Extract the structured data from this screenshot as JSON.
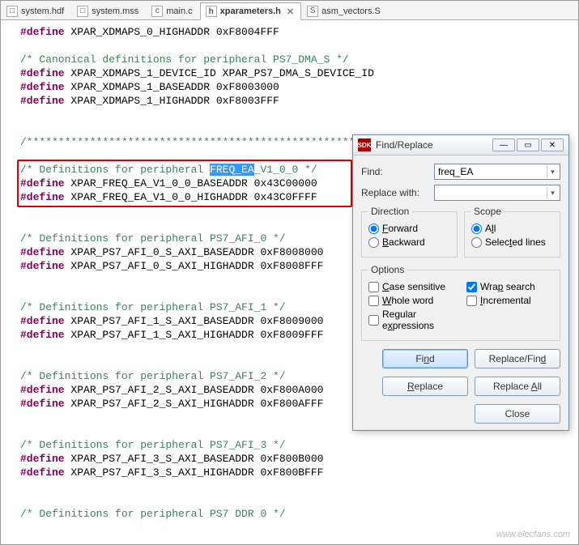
{
  "tabs": [
    {
      "label": "system.hdf",
      "active": false
    },
    {
      "label": "system.mss",
      "active": false
    },
    {
      "label": "main.c",
      "active": false
    },
    {
      "label": "xparameters.h",
      "active": true
    },
    {
      "label": "asm_vectors.S",
      "active": false
    }
  ],
  "code": {
    "lines": [
      {
        "type": "define",
        "ident": "XPAR_XDMAPS_0_HIGHADDR",
        "value": "0xF8004FFF"
      },
      {
        "type": "blank"
      },
      {
        "type": "comment",
        "text": "/* Canonical definitions for peripheral PS7_DMA_S */"
      },
      {
        "type": "define",
        "ident": "XPAR_XDMAPS_1_DEVICE_ID",
        "value": "XPAR_PS7_DMA_S_DEVICE_ID"
      },
      {
        "type": "define",
        "ident": "XPAR_XDMAPS_1_BASEADDR",
        "value": "0xF8003000"
      },
      {
        "type": "define",
        "ident": "XPAR_XDMAPS_1_HIGHADDR",
        "value": "0xF8003FFF"
      },
      {
        "type": "blank"
      },
      {
        "type": "blank"
      },
      {
        "type": "comment",
        "text": "/******************************************************************/"
      },
      {
        "type": "blank"
      },
      {
        "type": "comment_highlight",
        "prefix": "/* Definitions for peripheral ",
        "highlight": "FREQ_EA",
        "suffix": "_V1_0_0 */"
      },
      {
        "type": "define",
        "ident": "XPAR_FREQ_EA_V1_0_0_BASEADDR",
        "value": "0x43C00000"
      },
      {
        "type": "define",
        "ident": "XPAR_FREQ_EA_V1_0_0_HIGHADDR",
        "value": "0x43C0FFFF"
      },
      {
        "type": "blank"
      },
      {
        "type": "blank"
      },
      {
        "type": "comment",
        "text": "/* Definitions for peripheral PS7_AFI_0 */"
      },
      {
        "type": "define",
        "ident": "XPAR_PS7_AFI_0_S_AXI_BASEADDR",
        "value": "0xF8008000"
      },
      {
        "type": "define",
        "ident": "XPAR_PS7_AFI_0_S_AXI_HIGHADDR",
        "value": "0xF8008FFF"
      },
      {
        "type": "blank"
      },
      {
        "type": "blank"
      },
      {
        "type": "comment",
        "text": "/* Definitions for peripheral PS7_AFI_1 */"
      },
      {
        "type": "define",
        "ident": "XPAR_PS7_AFI_1_S_AXI_BASEADDR",
        "value": "0xF8009000"
      },
      {
        "type": "define",
        "ident": "XPAR_PS7_AFI_1_S_AXI_HIGHADDR",
        "value": "0xF8009FFF"
      },
      {
        "type": "blank"
      },
      {
        "type": "blank"
      },
      {
        "type": "comment",
        "text": "/* Definitions for peripheral PS7_AFI_2 */"
      },
      {
        "type": "define",
        "ident": "XPAR_PS7_AFI_2_S_AXI_BASEADDR",
        "value": "0xF800A000"
      },
      {
        "type": "define",
        "ident": "XPAR_PS7_AFI_2_S_AXI_HIGHADDR",
        "value": "0xF800AFFF"
      },
      {
        "type": "blank"
      },
      {
        "type": "blank"
      },
      {
        "type": "comment",
        "text": "/* Definitions for peripheral PS7_AFI_3 */"
      },
      {
        "type": "define",
        "ident": "XPAR_PS7_AFI_3_S_AXI_BASEADDR",
        "value": "0xF800B000"
      },
      {
        "type": "define",
        "ident": "XPAR_PS7_AFI_3_S_AXI_HIGHADDR",
        "value": "0xF800BFFF"
      },
      {
        "type": "blank"
      },
      {
        "type": "blank"
      },
      {
        "type": "comment",
        "text": "/* Definitions for peripheral PS7 DDR 0 */"
      }
    ],
    "redbox": {
      "firstLine": 10,
      "lastLine": 12
    }
  },
  "dialog": {
    "title": "Find/Replace",
    "find_label": "Find:",
    "find_value": "freq_EA",
    "replace_label": "Replace with:",
    "replace_value": "",
    "direction_legend": "Direction",
    "dir_forward": "Forward",
    "dir_backward": "Backward",
    "scope_legend": "Scope",
    "scope_all": "All",
    "scope_selected": "Selected lines",
    "options_legend": "Options",
    "opt_case": "Case sensitive",
    "opt_wrap": "Wrap search",
    "opt_whole": "Whole word",
    "opt_incremental": "Incremental",
    "opt_regex": "Regular expressions",
    "btn_find": "Find",
    "btn_replace_find": "Replace/Find",
    "btn_replace": "Replace",
    "btn_replace_all": "Replace All",
    "btn_close": "Close",
    "state": {
      "dir_forward": true,
      "scope_all": true,
      "wrap_search": true
    }
  },
  "watermark": "www.elecfans.com"
}
